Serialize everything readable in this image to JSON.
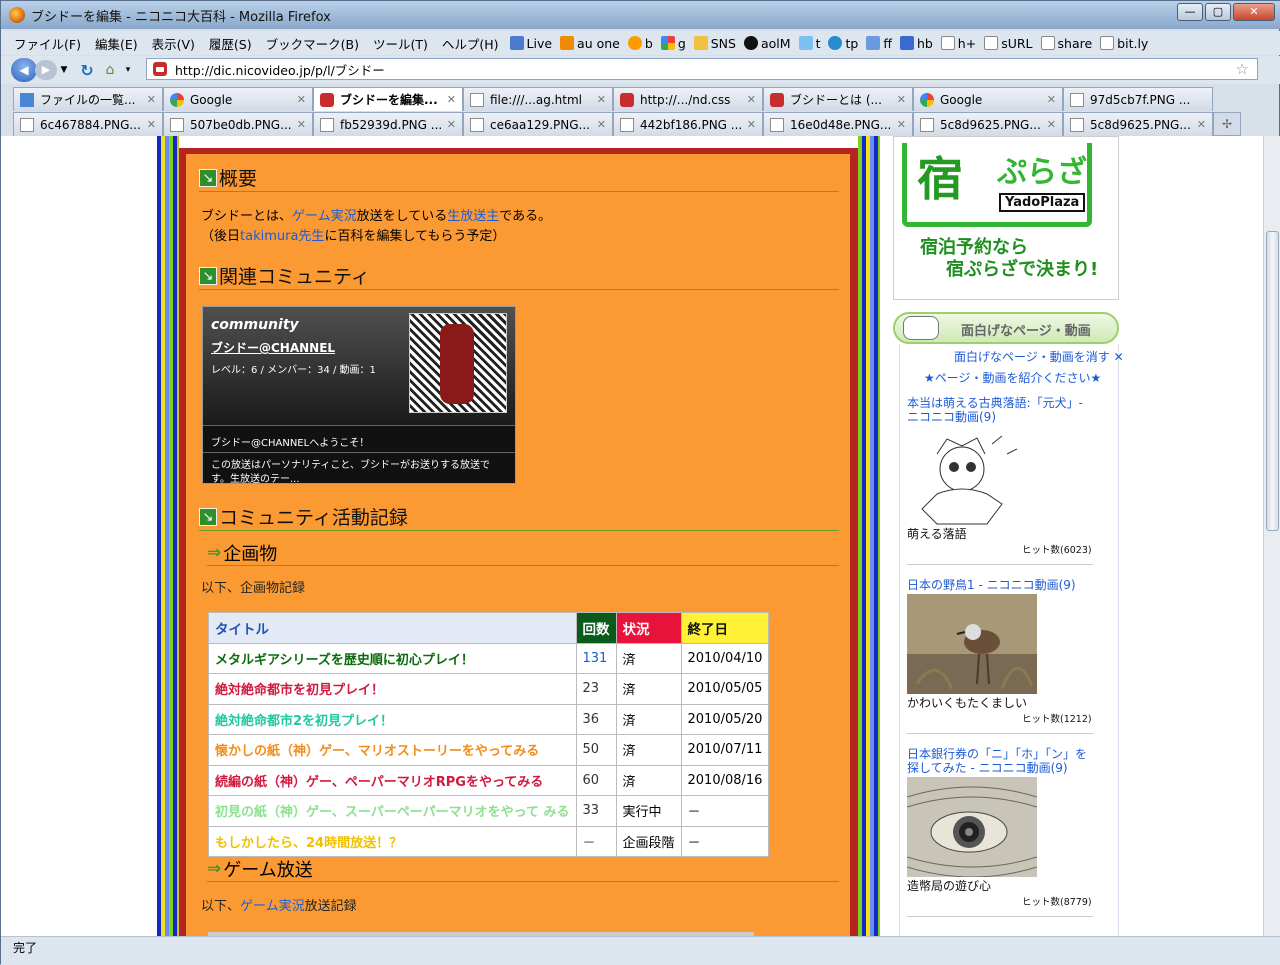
{
  "window": {
    "title": "ブシドーを編集 - ニコニコ大百科 - Mozilla Firefox",
    "min": "—",
    "max": "▢",
    "close": "✕"
  },
  "menu": [
    "ファイル(F)",
    "編集(E)",
    "表示(V)",
    "履歴(S)",
    "ブックマーク(B)",
    "ツール(T)",
    "ヘルプ(H)"
  ],
  "bookmarks": [
    "Live",
    "au one",
    "b",
    "g",
    "SNS",
    "aolM",
    "t",
    "tp",
    "ff",
    "hb",
    "h+",
    "sURL",
    "share",
    "bit.ly"
  ],
  "nav": {
    "url": "http://dic.nicovideo.jp/p/l/ブシドー"
  },
  "tabs1": [
    {
      "label": "ファイルの一覧...",
      "icon": "ie"
    },
    {
      "label": "Google",
      "icon": "g"
    },
    {
      "label": "ブシドーを編集...",
      "icon": "nn",
      "active": true
    },
    {
      "label": "file:///...ag.html",
      "icon": "doc"
    },
    {
      "label": "http://.../nd.css",
      "icon": "nn"
    },
    {
      "label": "ブシドーとは (...",
      "icon": "nn"
    },
    {
      "label": "Google",
      "icon": "g"
    },
    {
      "label": "97d5cb7f.PNG ...",
      "icon": "doc"
    }
  ],
  "tabs2": [
    "6c467884.PNG...",
    "507be0db.PNG...",
    "fb52939d.PNG ...",
    "ce6aa129.PNG...",
    "442bf186.PNG ...",
    "16e0d48e.PNG...",
    "5c8d9625.PNG...",
    "5c8d9625.PNG..."
  ],
  "status": "完了",
  "content": {
    "h_gaiyou": "概要",
    "gaiyou_1a": "ブシドーとは、",
    "gaiyou_1b": "ゲーム実況",
    "gaiyou_1c": "放送をしている",
    "gaiyou_1d": "生放送主",
    "gaiyou_1e": "である。",
    "gaiyou_2a": "（後日",
    "gaiyou_2b": "takimura先生",
    "gaiyou_2c": "に百科を編集してもらう予定）",
    "h_comm": "関連コミュニティ",
    "community": {
      "label": "community",
      "name": "ブシドー@CHANNEL",
      "stats": "レベル：6 / メンバー：34 / 動画：1",
      "welcome": "ブシドー@CHANNELへようこそ！",
      "desc": "この放送はパーソナリティこと、ブシドーがお送りする放送です。生放送のテー..."
    },
    "h_katsudou": "コミュニティ活動記録",
    "h_kikaku": "企画物",
    "kikaku_note": "以下、企画物記録",
    "table": {
      "headers": [
        "タイトル",
        "回数",
        "状況",
        "終了日"
      ],
      "rows": [
        {
          "title": "メタルギアシリーズを歴史順に初心プレイ！",
          "count": "131",
          "status": "済",
          "date": "2010/04/10",
          "color": "#0b6b0b",
          "countColor": "#1d5bd6"
        },
        {
          "title": "絶対絶命都市を初見プレイ！",
          "count": "23",
          "status": "済",
          "date": "2010/05/05",
          "color": "#d21a3e",
          "countColor": "#333"
        },
        {
          "title": "絶対絶命都市2を初見プレイ！",
          "count": "36",
          "status": "済",
          "date": "2010/05/20",
          "color": "#23c7a0",
          "countColor": "#333"
        },
        {
          "title": "懐かしの紙（神）ゲー、マリオストーリーをやってみる",
          "count": "50",
          "status": "済",
          "date": "2010/07/11",
          "color": "#f28d1c",
          "countColor": "#333"
        },
        {
          "title": "続編の紙（神）ゲー、ペーパーマリオRPGをやってみる",
          "count": "60",
          "status": "済",
          "date": "2010/08/16",
          "color": "#d21a3e",
          "countColor": "#333"
        },
        {
          "title": "初見の紙（神）ゲー、スーパーペーパーマリオをやって みる",
          "count": "33",
          "status": "実行中",
          "date": "－",
          "color": "#8fe08f",
          "countColor": "#333"
        },
        {
          "title": "もしかしたら、24時間放送！？",
          "count": "－",
          "status": "企画段階",
          "date": "－",
          "color": "#f0c000",
          "countColor": "#333"
        }
      ]
    },
    "h_game": "ゲーム放送",
    "game_a": "以下、",
    "game_b": "ゲーム実況",
    "game_c": "放送記録"
  },
  "sidebar": {
    "ad": {
      "kanji": "宿",
      "kana": "ぷらざ",
      "latin": "YadoPlaza",
      "copy1": "宿泊予約なら",
      "copy2": "宿ぷらざで決まり!"
    },
    "omo_title": "面白げなページ・動画",
    "hide": "面白げなページ・動画を消す ✕",
    "intro": "★ページ・動画を紹介ください★",
    "items": [
      {
        "title": "本当は萌える古典落語:「元犬」- ニコニコ動画(9)",
        "caption": "萌える落語",
        "hits": "ヒット数(6023)"
      },
      {
        "title": "日本の野鳥1 - ニコニコ動画(9)",
        "caption": "かわいくもたくましい",
        "hits": "ヒット数(1212)"
      },
      {
        "title": "日本銀行券の「ニ」「ホ」「ン」を探してみた - ニコニコ動画(9)",
        "caption": "造幣局の遊び心",
        "hits": "ヒット数(8779)"
      }
    ]
  }
}
